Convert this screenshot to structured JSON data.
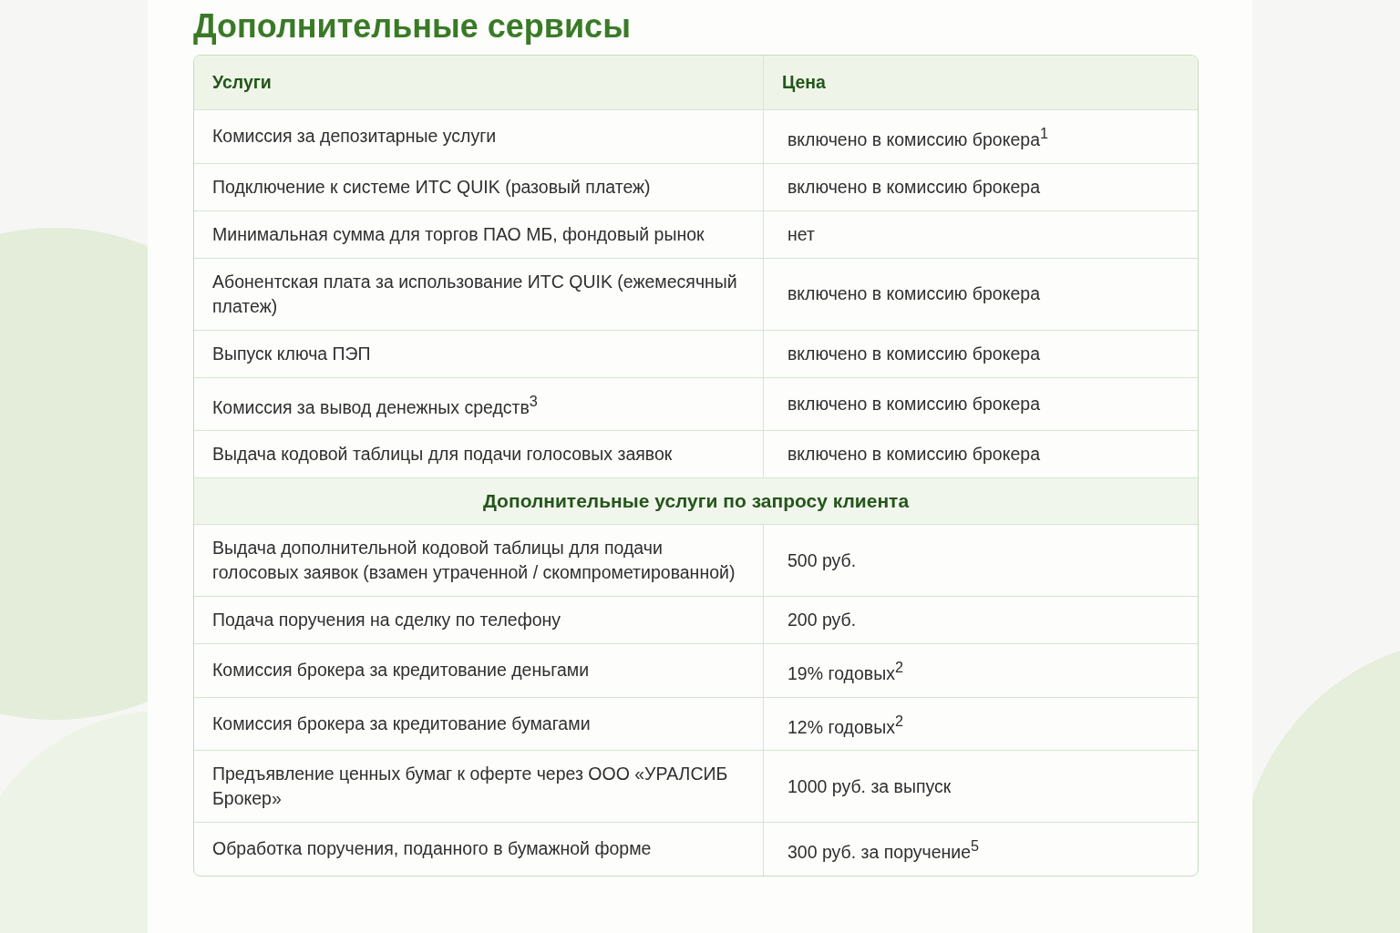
{
  "title": "Дополнительные сервисы",
  "table": {
    "columns": [
      "Услуги",
      "Цена"
    ],
    "rows": [
      {
        "kind": "row",
        "service": "Комиссия за депозитарные услуги",
        "price": "включено в комиссию брокера$^{1}$"
      },
      {
        "kind": "row",
        "service": "Подключение к системе ИТС QUIK (разовый платеж)",
        "price": "включено в комиссию брокера"
      },
      {
        "kind": "row",
        "service": "Минимальная сумма для торгов ПАО МБ, фондовый рынок",
        "price": "нет"
      },
      {
        "kind": "row",
        "service": "Абонентская плата за использование ИТС QUIK (ежемесячный платеж)",
        "price": "включено в комиссию брокера"
      },
      {
        "kind": "row",
        "service": "Выпуск ключа ПЭП",
        "price": "включено в комиссию брокера"
      },
      {
        "kind": "row",
        "service": "Комиссия за вывод денежных средств$^{3}$",
        "price": "включено в комиссию брокера"
      },
      {
        "kind": "row",
        "service": "Выдача кодовой таблицы для подачи голосовых заявок",
        "price": "включено в комиссию брокера"
      },
      {
        "kind": "section",
        "title": "Дополнительные услуги по запросу клиента"
      },
      {
        "kind": "row",
        "service": "Выдача дополнительной кодовой таблицы для подачи голосовых заявок (взамен утраченной / скомпрометированной)",
        "price": "500 руб."
      },
      {
        "kind": "row",
        "service": "Подача поручения на сделку по телефону",
        "price": "200 руб."
      },
      {
        "kind": "row",
        "service": "Комиссия брокера за кредитование деньгами",
        "price": "19% годовых$^{2}$"
      },
      {
        "kind": "row",
        "service": "Комиссия брокера за кредитование бумагами",
        "price": "12% годовых$^{2}$"
      },
      {
        "kind": "row",
        "service": "Предъявление ценных бумаг к оферте через ООО «УРАЛСИБ Брокер»",
        "price": "1000 руб. за выпуск"
      },
      {
        "kind": "row",
        "service": "Обработка поручения, поданного в бумажной форме",
        "price": "300 руб. за поручение$^{5}$"
      }
    ]
  }
}
